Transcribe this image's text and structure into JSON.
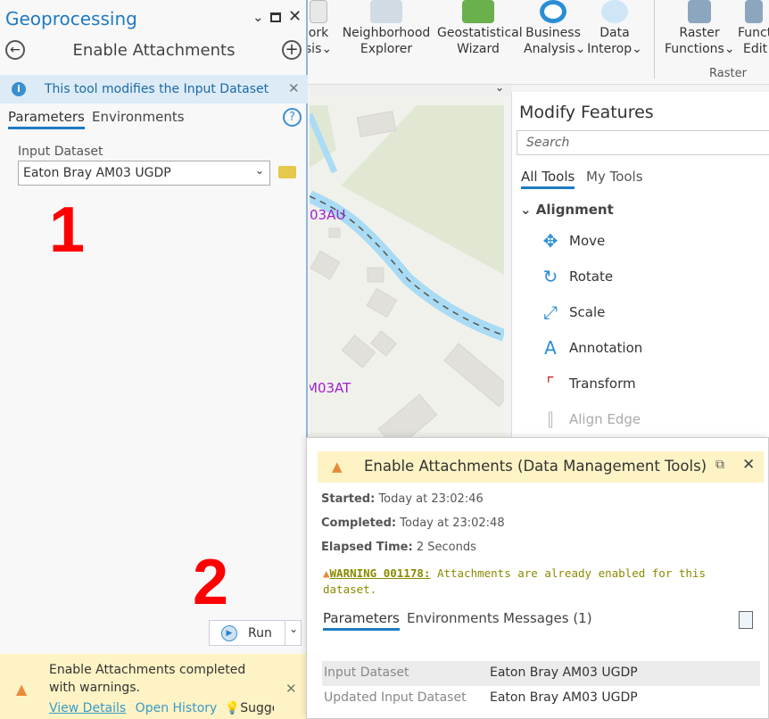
{
  "ribbon": {
    "items": [
      {
        "l1": "ork",
        "l2": "sis",
        "dropdown": true
      },
      {
        "l1": "Neighborhood",
        "l2": "Explorer"
      },
      {
        "l1": "Geostatistical",
        "l2": "Wizard"
      },
      {
        "l1": "Business",
        "l2": "Analysis",
        "dropdown": true
      },
      {
        "l1": "Data",
        "l2": "Interop",
        "dropdown": true
      },
      {
        "l1": "Raster",
        "l2": "Functions",
        "dropdown": true
      },
      {
        "l1": "Functi",
        "l2": "Edit"
      }
    ],
    "group_label": "Raster"
  },
  "map": {
    "labels": [
      "03AU",
      "M03AT"
    ]
  },
  "modify": {
    "title": "Modify Features",
    "search_placeholder": "Search",
    "tabs": [
      "All Tools",
      "My Tools"
    ],
    "group": "Alignment",
    "tools": [
      "Move",
      "Rotate",
      "Scale",
      "Annotation",
      "Transform",
      "Align Edge"
    ]
  },
  "geoprocessing": {
    "title": "Geoprocessing",
    "tool_title": "Enable Attachments",
    "info": "This tool modifies the Input Dataset",
    "tabs": [
      "Parameters",
      "Environments"
    ],
    "input_label": "Input Dataset",
    "input_value": "Eaton Bray AM03 UGDP",
    "run_label": "Run",
    "notification": {
      "text": "Enable Attachments completed with warnings.",
      "links": [
        "View Details",
        "Open History",
        "Sugges"
      ]
    }
  },
  "annotations": [
    "1",
    "2"
  ],
  "popup": {
    "title": "Enable Attachments (Data Management Tools)",
    "started_label": "Started:",
    "started": "Today at 23:02:46",
    "completed_label": "Completed:",
    "completed": "Today at 23:02:48",
    "elapsed_label": "Elapsed Time:",
    "elapsed": "2 Seconds",
    "warning_code": "WARNING 001178:",
    "warning_text": " Attachments are already enabled for this dataset.",
    "tabs": [
      "Parameters",
      "Environments",
      "Messages (1)"
    ],
    "rows": [
      {
        "name": "Input Dataset",
        "value": "Eaton Bray AM03 UGDP"
      },
      {
        "name": "Updated Input Dataset",
        "value": "Eaton Bray AM03 UGDP"
      }
    ]
  },
  "colors": {
    "accent": "#1f7ac2",
    "warning_bg": "#fdf3c4",
    "annotation": "#ff0000",
    "warning_text": "#8a8a00"
  }
}
